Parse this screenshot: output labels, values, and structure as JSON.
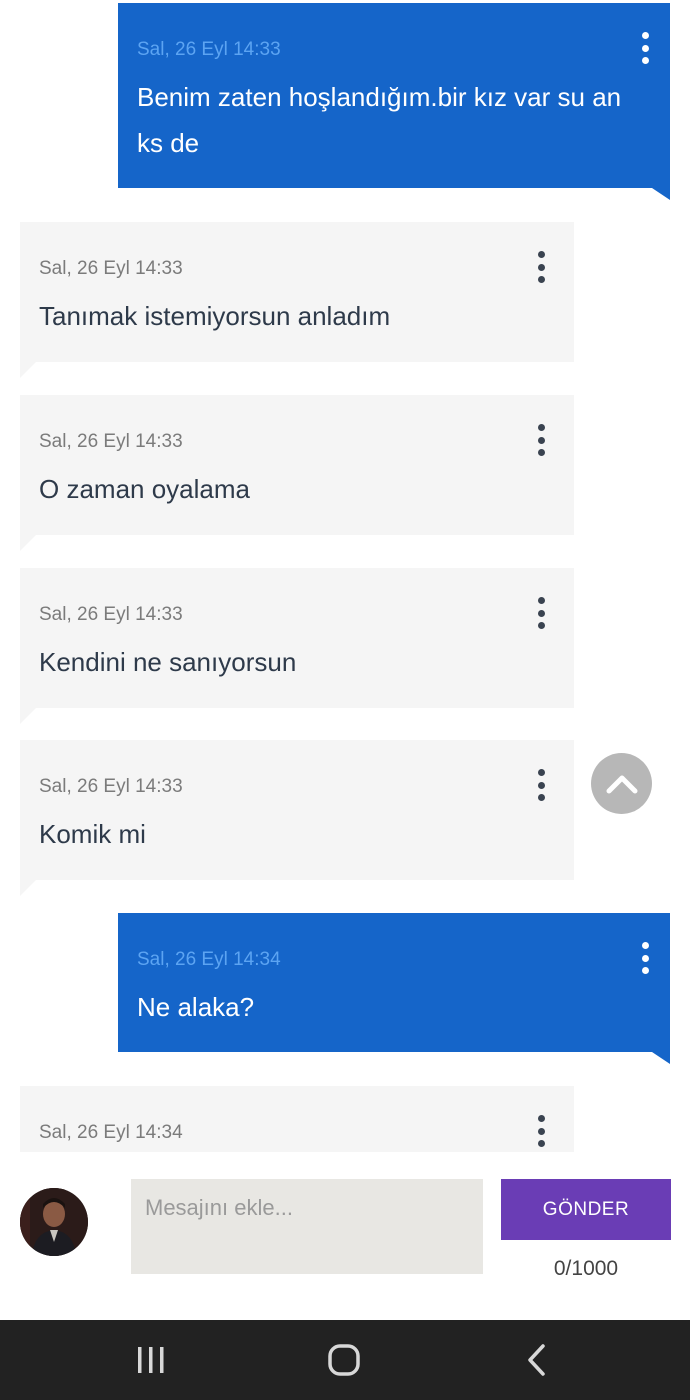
{
  "messages": [
    {
      "direction": "out",
      "time": "Sal, 26 Eyl 14:33",
      "text": "Benim zaten hoşlandığım.bir kız var su an ks de"
    },
    {
      "direction": "in",
      "time": "Sal, 26 Eyl 14:33",
      "text": "Tanımak istemiyorsun anladım"
    },
    {
      "direction": "in",
      "time": "Sal, 26 Eyl 14:33",
      "text": "O zaman oyalama"
    },
    {
      "direction": "in",
      "time": "Sal, 26 Eyl 14:33",
      "text": "Kendini ne sanıyorsun"
    },
    {
      "direction": "in",
      "time": "Sal, 26 Eyl 14:33",
      "text": "Komik mi"
    },
    {
      "direction": "out",
      "time": "Sal, 26 Eyl 14:34",
      "text": "Ne alaka?"
    },
    {
      "direction": "in",
      "time": "Sal, 26 Eyl 14:34",
      "text": ""
    }
  ],
  "composer": {
    "placeholder": "Mesajını ekle...",
    "value": "",
    "send_label": "GÖNDER",
    "counter": "0/1000"
  },
  "icons": {
    "message_menu": "more-vertical-icon",
    "scroll_top": "chevron-up-icon",
    "nav_recent": "recent-apps-icon",
    "nav_home": "home-icon",
    "nav_back": "back-icon"
  },
  "colors": {
    "outgoing_bubble": "#1565c9",
    "incoming_bubble": "#f5f5f5",
    "send_button": "#6a3db5",
    "navbar": "#222222"
  }
}
